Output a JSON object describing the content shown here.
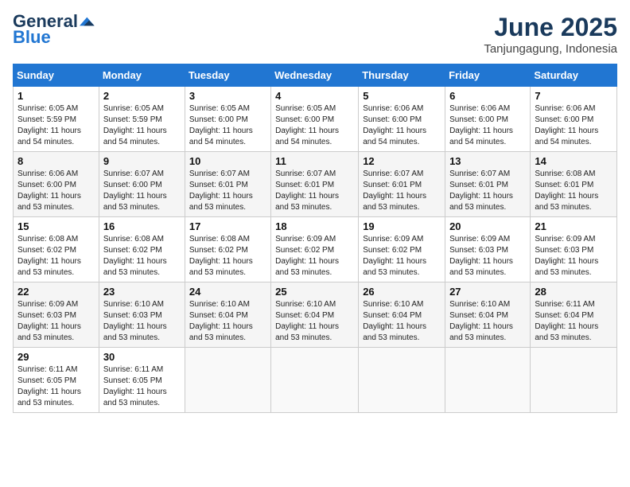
{
  "header": {
    "logo_general": "General",
    "logo_blue": "Blue",
    "month_title": "June 2025",
    "location": "Tanjungagung, Indonesia"
  },
  "weekdays": [
    "Sunday",
    "Monday",
    "Tuesday",
    "Wednesday",
    "Thursday",
    "Friday",
    "Saturday"
  ],
  "weeks": [
    [
      {
        "day": "1",
        "sunrise": "6:05 AM",
        "sunset": "5:59 PM",
        "daylight": "11 hours and 54 minutes."
      },
      {
        "day": "2",
        "sunrise": "6:05 AM",
        "sunset": "5:59 PM",
        "daylight": "11 hours and 54 minutes."
      },
      {
        "day": "3",
        "sunrise": "6:05 AM",
        "sunset": "6:00 PM",
        "daylight": "11 hours and 54 minutes."
      },
      {
        "day": "4",
        "sunrise": "6:05 AM",
        "sunset": "6:00 PM",
        "daylight": "11 hours and 54 minutes."
      },
      {
        "day": "5",
        "sunrise": "6:06 AM",
        "sunset": "6:00 PM",
        "daylight": "11 hours and 54 minutes."
      },
      {
        "day": "6",
        "sunrise": "6:06 AM",
        "sunset": "6:00 PM",
        "daylight": "11 hours and 54 minutes."
      },
      {
        "day": "7",
        "sunrise": "6:06 AM",
        "sunset": "6:00 PM",
        "daylight": "11 hours and 54 minutes."
      }
    ],
    [
      {
        "day": "8",
        "sunrise": "6:06 AM",
        "sunset": "6:00 PM",
        "daylight": "11 hours and 53 minutes."
      },
      {
        "day": "9",
        "sunrise": "6:07 AM",
        "sunset": "6:00 PM",
        "daylight": "11 hours and 53 minutes."
      },
      {
        "day": "10",
        "sunrise": "6:07 AM",
        "sunset": "6:01 PM",
        "daylight": "11 hours and 53 minutes."
      },
      {
        "day": "11",
        "sunrise": "6:07 AM",
        "sunset": "6:01 PM",
        "daylight": "11 hours and 53 minutes."
      },
      {
        "day": "12",
        "sunrise": "6:07 AM",
        "sunset": "6:01 PM",
        "daylight": "11 hours and 53 minutes."
      },
      {
        "day": "13",
        "sunrise": "6:07 AM",
        "sunset": "6:01 PM",
        "daylight": "11 hours and 53 minutes."
      },
      {
        "day": "14",
        "sunrise": "6:08 AM",
        "sunset": "6:01 PM",
        "daylight": "11 hours and 53 minutes."
      }
    ],
    [
      {
        "day": "15",
        "sunrise": "6:08 AM",
        "sunset": "6:02 PM",
        "daylight": "11 hours and 53 minutes."
      },
      {
        "day": "16",
        "sunrise": "6:08 AM",
        "sunset": "6:02 PM",
        "daylight": "11 hours and 53 minutes."
      },
      {
        "day": "17",
        "sunrise": "6:08 AM",
        "sunset": "6:02 PM",
        "daylight": "11 hours and 53 minutes."
      },
      {
        "day": "18",
        "sunrise": "6:09 AM",
        "sunset": "6:02 PM",
        "daylight": "11 hours and 53 minutes."
      },
      {
        "day": "19",
        "sunrise": "6:09 AM",
        "sunset": "6:02 PM",
        "daylight": "11 hours and 53 minutes."
      },
      {
        "day": "20",
        "sunrise": "6:09 AM",
        "sunset": "6:03 PM",
        "daylight": "11 hours and 53 minutes."
      },
      {
        "day": "21",
        "sunrise": "6:09 AM",
        "sunset": "6:03 PM",
        "daylight": "11 hours and 53 minutes."
      }
    ],
    [
      {
        "day": "22",
        "sunrise": "6:09 AM",
        "sunset": "6:03 PM",
        "daylight": "11 hours and 53 minutes."
      },
      {
        "day": "23",
        "sunrise": "6:10 AM",
        "sunset": "6:03 PM",
        "daylight": "11 hours and 53 minutes."
      },
      {
        "day": "24",
        "sunrise": "6:10 AM",
        "sunset": "6:04 PM",
        "daylight": "11 hours and 53 minutes."
      },
      {
        "day": "25",
        "sunrise": "6:10 AM",
        "sunset": "6:04 PM",
        "daylight": "11 hours and 53 minutes."
      },
      {
        "day": "26",
        "sunrise": "6:10 AM",
        "sunset": "6:04 PM",
        "daylight": "11 hours and 53 minutes."
      },
      {
        "day": "27",
        "sunrise": "6:10 AM",
        "sunset": "6:04 PM",
        "daylight": "11 hours and 53 minutes."
      },
      {
        "day": "28",
        "sunrise": "6:11 AM",
        "sunset": "6:04 PM",
        "daylight": "11 hours and 53 minutes."
      }
    ],
    [
      {
        "day": "29",
        "sunrise": "6:11 AM",
        "sunset": "6:05 PM",
        "daylight": "11 hours and 53 minutes."
      },
      {
        "day": "30",
        "sunrise": "6:11 AM",
        "sunset": "6:05 PM",
        "daylight": "11 hours and 53 minutes."
      },
      null,
      null,
      null,
      null,
      null
    ]
  ]
}
